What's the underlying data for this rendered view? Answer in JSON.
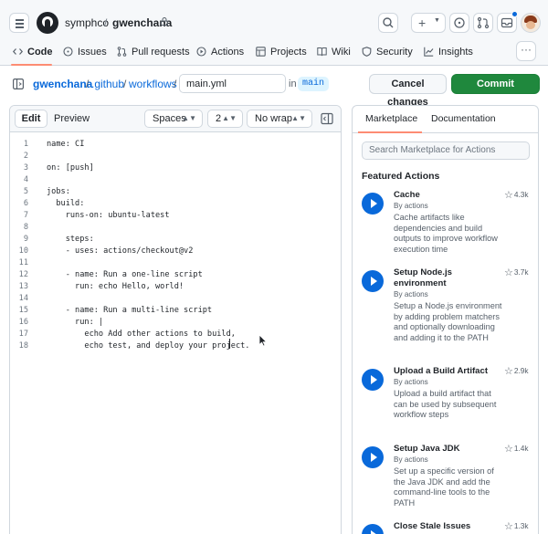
{
  "header": {
    "owner": "symphco",
    "separator": "/",
    "repo": "gwenchana",
    "new_label": "+",
    "icons": [
      "menu-icon",
      "github-logo",
      "lock-icon",
      "search-icon",
      "plus-icon",
      "issues-icon",
      "pull-requests-icon",
      "inbox-icon",
      "avatar"
    ]
  },
  "repo_nav": {
    "tabs": [
      {
        "label": "Code",
        "icon": "code-icon"
      },
      {
        "label": "Issues",
        "icon": "issue-icon"
      },
      {
        "label": "Pull requests",
        "icon": "pull-request-icon"
      },
      {
        "label": "Actions",
        "icon": "play-icon"
      },
      {
        "label": "Projects",
        "icon": "table-icon"
      },
      {
        "label": "Wiki",
        "icon": "book-icon"
      },
      {
        "label": "Security",
        "icon": "shield-icon"
      },
      {
        "label": "Insights",
        "icon": "graph-icon"
      }
    ],
    "more": "···"
  },
  "path": {
    "owner": "gwenchana",
    "sep": "/",
    "seg1": ".github",
    "seg2": "workflows",
    "filename": "main.yml",
    "in_label": "in",
    "branch": "main",
    "cancel_label": "Cancel changes",
    "commit_label": "Commit changes..."
  },
  "editor": {
    "tab_edit": "Edit",
    "tab_preview": "Preview",
    "indent_mode": "Spaces",
    "indent_size": "2",
    "wrap_mode": "No wrap",
    "lines": [
      {
        "n": "1",
        "text": "name: CI"
      },
      {
        "n": "2",
        "text": ""
      },
      {
        "n": "3",
        "text": "on: [push]"
      },
      {
        "n": "4",
        "text": ""
      },
      {
        "n": "5",
        "text": "jobs:"
      },
      {
        "n": "6",
        "text": "  build:"
      },
      {
        "n": "7",
        "text": "    runs-on: ubuntu-latest"
      },
      {
        "n": "8",
        "text": ""
      },
      {
        "n": "9",
        "text": "    steps:"
      },
      {
        "n": "10",
        "text": "    - uses: actions/checkout@v2"
      },
      {
        "n": "11",
        "text": ""
      },
      {
        "n": "12",
        "text": "    - name: Run a one-line script"
      },
      {
        "n": "13",
        "text": "      run: echo Hello, world!"
      },
      {
        "n": "14",
        "text": ""
      },
      {
        "n": "15",
        "text": "    - name: Run a multi-line script"
      },
      {
        "n": "16",
        "text": "      run: |"
      },
      {
        "n": "17",
        "text": "        echo Add other actions to build,"
      },
      {
        "n": "18",
        "text": "        echo test, and deploy your project."
      }
    ]
  },
  "marketplace": {
    "tab_marketplace": "Marketplace",
    "tab_documentation": "Documentation",
    "search_placeholder": "Search Marketplace for Actions",
    "featured_heading": "Featured Actions",
    "actions": [
      {
        "title": "Cache",
        "by": "By actions",
        "desc": "Cache artifacts like dependencies and build outputs to improve workflow execution time",
        "stars": "4.3k"
      },
      {
        "title": "Setup Node.js environment",
        "by": "By actions",
        "desc": "Setup a Node.js environment by adding problem matchers and optionally downloading and adding it to the PATH",
        "stars": "3.7k"
      },
      {
        "title": "Upload a Build Artifact",
        "by": "By actions",
        "desc": "Upload a build artifact that can be used by subsequent workflow steps",
        "stars": "2.9k"
      },
      {
        "title": "Setup Java JDK",
        "by": "By actions",
        "desc": "Set up a specific version of the Java JDK and add the command-line tools to the PATH",
        "stars": "1.4k"
      },
      {
        "title": "Close Stale Issues",
        "by": "",
        "desc": "",
        "stars": "1.3k"
      }
    ]
  }
}
